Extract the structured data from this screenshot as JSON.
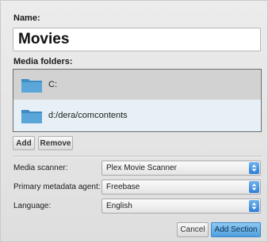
{
  "dialog": {
    "name_label": "Name:",
    "name_value": "Movies",
    "folders_label": "Media folders:",
    "folders": [
      {
        "path": "C:",
        "icon": "folder-icon"
      },
      {
        "path": "d:/dera/comcontents",
        "icon": "folder-icon"
      }
    ],
    "add_label": "Add",
    "remove_label": "Remove",
    "scanner_label": "Media scanner:",
    "scanner_value": "Plex Movie Scanner",
    "agent_label": "Primary metadata agent:",
    "agent_value": "Freebase",
    "language_label": "Language:",
    "language_value": "English",
    "cancel_label": "Cancel",
    "add_section_label": "Add Section"
  },
  "colors": {
    "accent": "#4f9fdf",
    "folder": "#3d8cc4",
    "selected_row": "#d2d2d2"
  }
}
